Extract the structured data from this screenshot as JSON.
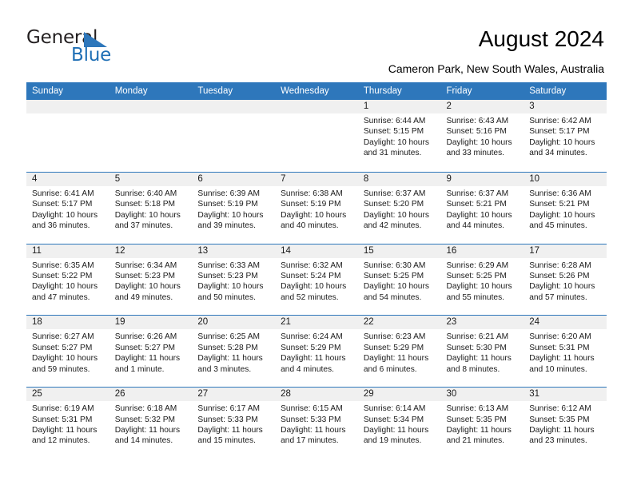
{
  "brand": {
    "name_part1": "General",
    "name_part2": "Blue",
    "mark_icon": "blue-triangle-logo-icon",
    "accent_color": "#1f6fb5"
  },
  "header": {
    "title": "August 2024",
    "location": "Cameron Park, New South Wales, Australia"
  },
  "colors": {
    "header_blue": "#2e77bb",
    "day_band_gray": "#f0f0f0",
    "cell_white": "#ffffff",
    "text": "#1a1a1a"
  },
  "weekday_headers": [
    "Sunday",
    "Monday",
    "Tuesday",
    "Wednesday",
    "Thursday",
    "Friday",
    "Saturday"
  ],
  "weeks": [
    [
      {
        "date": "",
        "empty": true,
        "sunrise": "",
        "sunset": "",
        "daylight_line1": "",
        "daylight_line2": ""
      },
      {
        "date": "",
        "empty": true,
        "sunrise": "",
        "sunset": "",
        "daylight_line1": "",
        "daylight_line2": ""
      },
      {
        "date": "",
        "empty": true,
        "sunrise": "",
        "sunset": "",
        "daylight_line1": "",
        "daylight_line2": ""
      },
      {
        "date": "",
        "empty": true,
        "sunrise": "",
        "sunset": "",
        "daylight_line1": "",
        "daylight_line2": ""
      },
      {
        "date": "1",
        "empty": false,
        "sunrise": "Sunrise: 6:44 AM",
        "sunset": "Sunset: 5:15 PM",
        "daylight_line1": "Daylight: 10 hours",
        "daylight_line2": "and 31 minutes."
      },
      {
        "date": "2",
        "empty": false,
        "sunrise": "Sunrise: 6:43 AM",
        "sunset": "Sunset: 5:16 PM",
        "daylight_line1": "Daylight: 10 hours",
        "daylight_line2": "and 33 minutes."
      },
      {
        "date": "3",
        "empty": false,
        "sunrise": "Sunrise: 6:42 AM",
        "sunset": "Sunset: 5:17 PM",
        "daylight_line1": "Daylight: 10 hours",
        "daylight_line2": "and 34 minutes."
      }
    ],
    [
      {
        "date": "4",
        "empty": false,
        "sunrise": "Sunrise: 6:41 AM",
        "sunset": "Sunset: 5:17 PM",
        "daylight_line1": "Daylight: 10 hours",
        "daylight_line2": "and 36 minutes."
      },
      {
        "date": "5",
        "empty": false,
        "sunrise": "Sunrise: 6:40 AM",
        "sunset": "Sunset: 5:18 PM",
        "daylight_line1": "Daylight: 10 hours",
        "daylight_line2": "and 37 minutes."
      },
      {
        "date": "6",
        "empty": false,
        "sunrise": "Sunrise: 6:39 AM",
        "sunset": "Sunset: 5:19 PM",
        "daylight_line1": "Daylight: 10 hours",
        "daylight_line2": "and 39 minutes."
      },
      {
        "date": "7",
        "empty": false,
        "sunrise": "Sunrise: 6:38 AM",
        "sunset": "Sunset: 5:19 PM",
        "daylight_line1": "Daylight: 10 hours",
        "daylight_line2": "and 40 minutes."
      },
      {
        "date": "8",
        "empty": false,
        "sunrise": "Sunrise: 6:37 AM",
        "sunset": "Sunset: 5:20 PM",
        "daylight_line1": "Daylight: 10 hours",
        "daylight_line2": "and 42 minutes."
      },
      {
        "date": "9",
        "empty": false,
        "sunrise": "Sunrise: 6:37 AM",
        "sunset": "Sunset: 5:21 PM",
        "daylight_line1": "Daylight: 10 hours",
        "daylight_line2": "and 44 minutes."
      },
      {
        "date": "10",
        "empty": false,
        "sunrise": "Sunrise: 6:36 AM",
        "sunset": "Sunset: 5:21 PM",
        "daylight_line1": "Daylight: 10 hours",
        "daylight_line2": "and 45 minutes."
      }
    ],
    [
      {
        "date": "11",
        "empty": false,
        "sunrise": "Sunrise: 6:35 AM",
        "sunset": "Sunset: 5:22 PM",
        "daylight_line1": "Daylight: 10 hours",
        "daylight_line2": "and 47 minutes."
      },
      {
        "date": "12",
        "empty": false,
        "sunrise": "Sunrise: 6:34 AM",
        "sunset": "Sunset: 5:23 PM",
        "daylight_line1": "Daylight: 10 hours",
        "daylight_line2": "and 49 minutes."
      },
      {
        "date": "13",
        "empty": false,
        "sunrise": "Sunrise: 6:33 AM",
        "sunset": "Sunset: 5:23 PM",
        "daylight_line1": "Daylight: 10 hours",
        "daylight_line2": "and 50 minutes."
      },
      {
        "date": "14",
        "empty": false,
        "sunrise": "Sunrise: 6:32 AM",
        "sunset": "Sunset: 5:24 PM",
        "daylight_line1": "Daylight: 10 hours",
        "daylight_line2": "and 52 minutes."
      },
      {
        "date": "15",
        "empty": false,
        "sunrise": "Sunrise: 6:30 AM",
        "sunset": "Sunset: 5:25 PM",
        "daylight_line1": "Daylight: 10 hours",
        "daylight_line2": "and 54 minutes."
      },
      {
        "date": "16",
        "empty": false,
        "sunrise": "Sunrise: 6:29 AM",
        "sunset": "Sunset: 5:25 PM",
        "daylight_line1": "Daylight: 10 hours",
        "daylight_line2": "and 55 minutes."
      },
      {
        "date": "17",
        "empty": false,
        "sunrise": "Sunrise: 6:28 AM",
        "sunset": "Sunset: 5:26 PM",
        "daylight_line1": "Daylight: 10 hours",
        "daylight_line2": "and 57 minutes."
      }
    ],
    [
      {
        "date": "18",
        "empty": false,
        "sunrise": "Sunrise: 6:27 AM",
        "sunset": "Sunset: 5:27 PM",
        "daylight_line1": "Daylight: 10 hours",
        "daylight_line2": "and 59 minutes."
      },
      {
        "date": "19",
        "empty": false,
        "sunrise": "Sunrise: 6:26 AM",
        "sunset": "Sunset: 5:27 PM",
        "daylight_line1": "Daylight: 11 hours",
        "daylight_line2": "and 1 minute."
      },
      {
        "date": "20",
        "empty": false,
        "sunrise": "Sunrise: 6:25 AM",
        "sunset": "Sunset: 5:28 PM",
        "daylight_line1": "Daylight: 11 hours",
        "daylight_line2": "and 3 minutes."
      },
      {
        "date": "21",
        "empty": false,
        "sunrise": "Sunrise: 6:24 AM",
        "sunset": "Sunset: 5:29 PM",
        "daylight_line1": "Daylight: 11 hours",
        "daylight_line2": "and 4 minutes."
      },
      {
        "date": "22",
        "empty": false,
        "sunrise": "Sunrise: 6:23 AM",
        "sunset": "Sunset: 5:29 PM",
        "daylight_line1": "Daylight: 11 hours",
        "daylight_line2": "and 6 minutes."
      },
      {
        "date": "23",
        "empty": false,
        "sunrise": "Sunrise: 6:21 AM",
        "sunset": "Sunset: 5:30 PM",
        "daylight_line1": "Daylight: 11 hours",
        "daylight_line2": "and 8 minutes."
      },
      {
        "date": "24",
        "empty": false,
        "sunrise": "Sunrise: 6:20 AM",
        "sunset": "Sunset: 5:31 PM",
        "daylight_line1": "Daylight: 11 hours",
        "daylight_line2": "and 10 minutes."
      }
    ],
    [
      {
        "date": "25",
        "empty": false,
        "sunrise": "Sunrise: 6:19 AM",
        "sunset": "Sunset: 5:31 PM",
        "daylight_line1": "Daylight: 11 hours",
        "daylight_line2": "and 12 minutes."
      },
      {
        "date": "26",
        "empty": false,
        "sunrise": "Sunrise: 6:18 AM",
        "sunset": "Sunset: 5:32 PM",
        "daylight_line1": "Daylight: 11 hours",
        "daylight_line2": "and 14 minutes."
      },
      {
        "date": "27",
        "empty": false,
        "sunrise": "Sunrise: 6:17 AM",
        "sunset": "Sunset: 5:33 PM",
        "daylight_line1": "Daylight: 11 hours",
        "daylight_line2": "and 15 minutes."
      },
      {
        "date": "28",
        "empty": false,
        "sunrise": "Sunrise: 6:15 AM",
        "sunset": "Sunset: 5:33 PM",
        "daylight_line1": "Daylight: 11 hours",
        "daylight_line2": "and 17 minutes."
      },
      {
        "date": "29",
        "empty": false,
        "sunrise": "Sunrise: 6:14 AM",
        "sunset": "Sunset: 5:34 PM",
        "daylight_line1": "Daylight: 11 hours",
        "daylight_line2": "and 19 minutes."
      },
      {
        "date": "30",
        "empty": false,
        "sunrise": "Sunrise: 6:13 AM",
        "sunset": "Sunset: 5:35 PM",
        "daylight_line1": "Daylight: 11 hours",
        "daylight_line2": "and 21 minutes."
      },
      {
        "date": "31",
        "empty": false,
        "sunrise": "Sunrise: 6:12 AM",
        "sunset": "Sunset: 5:35 PM",
        "daylight_line1": "Daylight: 11 hours",
        "daylight_line2": "and 23 minutes."
      }
    ]
  ]
}
